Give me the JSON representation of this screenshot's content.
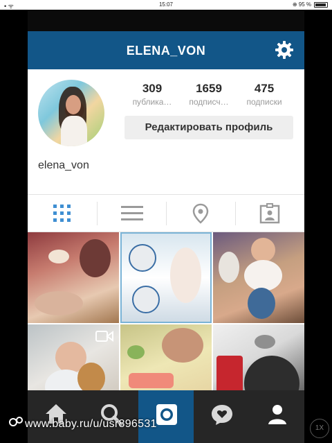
{
  "statusbar": {
    "left": "•  ᯤ",
    "time": "15:07",
    "battery": "⊕ 95 %"
  },
  "header": {
    "title": "ELENA_VON",
    "settings_icon": "gear-icon",
    "color": "#125688"
  },
  "profile": {
    "username": "elena_von",
    "stats": [
      {
        "value": "309",
        "label": "публика…"
      },
      {
        "value": "1659",
        "label": "подписч…"
      },
      {
        "value": "475",
        "label": "подписки"
      }
    ],
    "edit_button": "Редактировать профиль"
  },
  "tabs": [
    {
      "icon": "grid-icon",
      "active": true
    },
    {
      "icon": "list-icon",
      "active": false
    },
    {
      "icon": "location-pin-icon",
      "active": false
    },
    {
      "icon": "tagged-photos-icon",
      "active": false
    }
  ],
  "navbar": [
    {
      "icon": "home-icon"
    },
    {
      "icon": "search-icon"
    },
    {
      "icon": "camera-icon",
      "active": true
    },
    {
      "icon": "activity-icon"
    },
    {
      "icon": "profile-icon"
    }
  ],
  "watermark": "www.baby.ru/u/usr896531",
  "zoom": "1X"
}
